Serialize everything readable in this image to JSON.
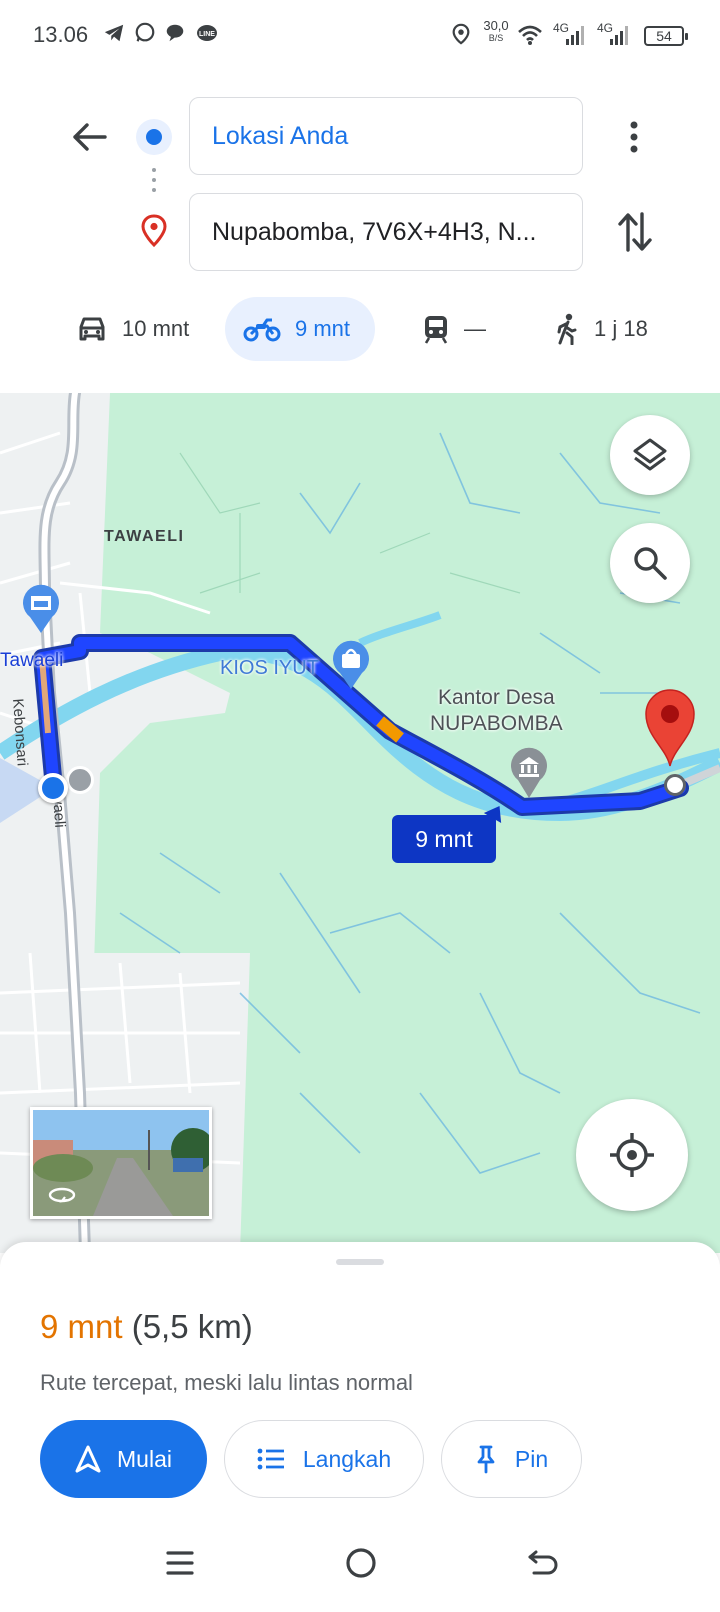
{
  "status_bar": {
    "time": "13.06",
    "net_speed_value": "30,0",
    "net_speed_unit": "B/S",
    "sim1": "4G",
    "sim2": "4G",
    "battery": "54"
  },
  "directions": {
    "origin": "Lokasi Anda",
    "destination": "Nupabomba, 7V6X+4H3, N..."
  },
  "modes": [
    {
      "name": "car",
      "label": "10 mnt"
    },
    {
      "name": "motorcycle",
      "label": "9 mnt",
      "selected": true
    },
    {
      "name": "transit",
      "label": "—"
    },
    {
      "name": "walk",
      "label": "1 j 18"
    }
  ],
  "map": {
    "labels": {
      "area": "TAWAELI",
      "road_west": "Tawaeli",
      "road_vertical": "Kebonsari",
      "road_vertical_2": "waeli",
      "shop": "KIOS IYUT",
      "office_line1": "Kantor Desa",
      "office_line2": "NUPABOMBA"
    },
    "route_badge": "9 mnt"
  },
  "route": {
    "duration": "9 mnt",
    "distance": "(5,5 km)",
    "description": "Rute tercepat, meski lalu lintas normal"
  },
  "actions": {
    "start": "Mulai",
    "steps": "Langkah",
    "pin": "Pin"
  },
  "colors": {
    "route": "#1a3fd6",
    "accent": "#1a73e8",
    "duration": "#e37400",
    "destination_pin": "#d93025"
  }
}
